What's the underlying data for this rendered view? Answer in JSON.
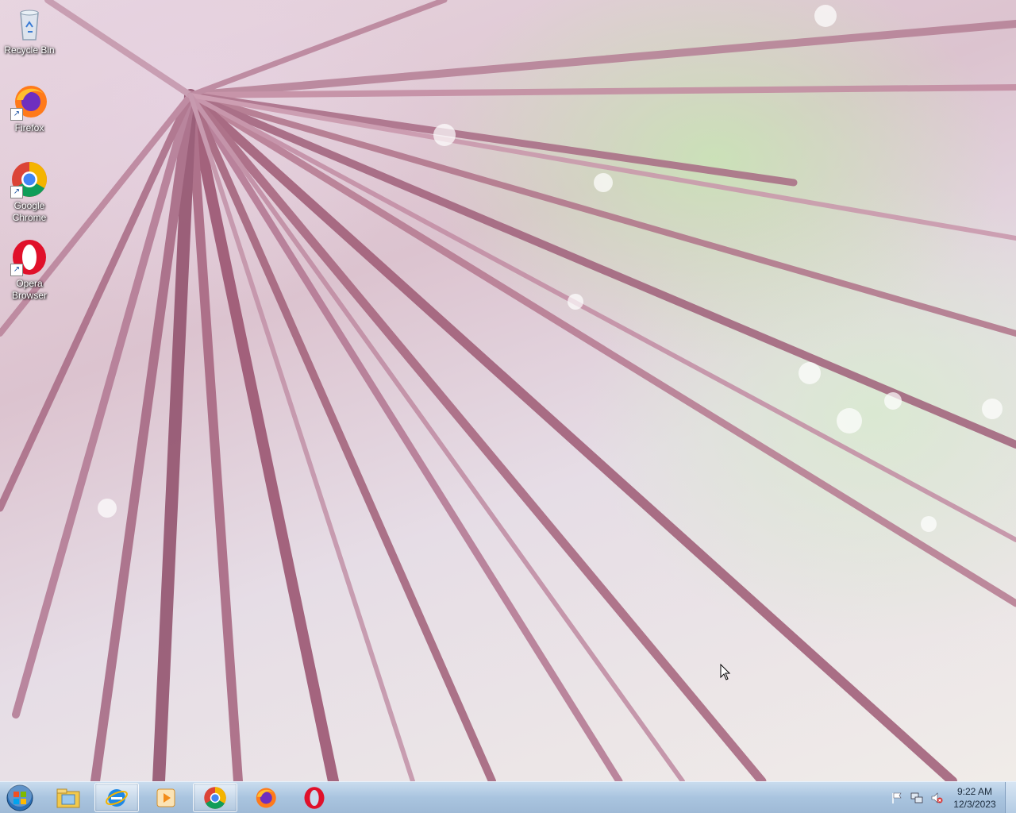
{
  "desktop": {
    "icons": [
      {
        "label": "Recycle Bin",
        "icon": "recycle-bin-icon"
      },
      {
        "label": "Firefox",
        "icon": "firefox-icon"
      },
      {
        "label": "Google Chrome",
        "icon": "chrome-icon"
      },
      {
        "label": "Opera Browser",
        "icon": "opera-icon"
      }
    ]
  },
  "taskbar": {
    "start_icon": "windows-start-icon",
    "pinned": [
      {
        "icon": "file-explorer-icon",
        "active": false
      },
      {
        "icon": "internet-explorer-icon",
        "active": true
      },
      {
        "icon": "media-player-icon",
        "active": false
      },
      {
        "icon": "chrome-icon",
        "active": true
      },
      {
        "icon": "firefox-icon",
        "active": false
      },
      {
        "icon": "opera-icon",
        "active": false
      }
    ],
    "tray": {
      "icons": [
        "action-center-flag-icon",
        "network-icon",
        "volume-muted-icon"
      ],
      "time": "9:22 AM",
      "date": "12/3/2023"
    }
  },
  "colors": {
    "taskbar": "#a9c4df",
    "desktop_label": "#ffffff",
    "chrome_red": "#db4437",
    "chrome_green": "#0f9d58",
    "chrome_yellow": "#f4b400",
    "chrome_blue": "#4285f4",
    "opera_red": "#e0102a",
    "firefox_orange": "#ff7a1a"
  }
}
